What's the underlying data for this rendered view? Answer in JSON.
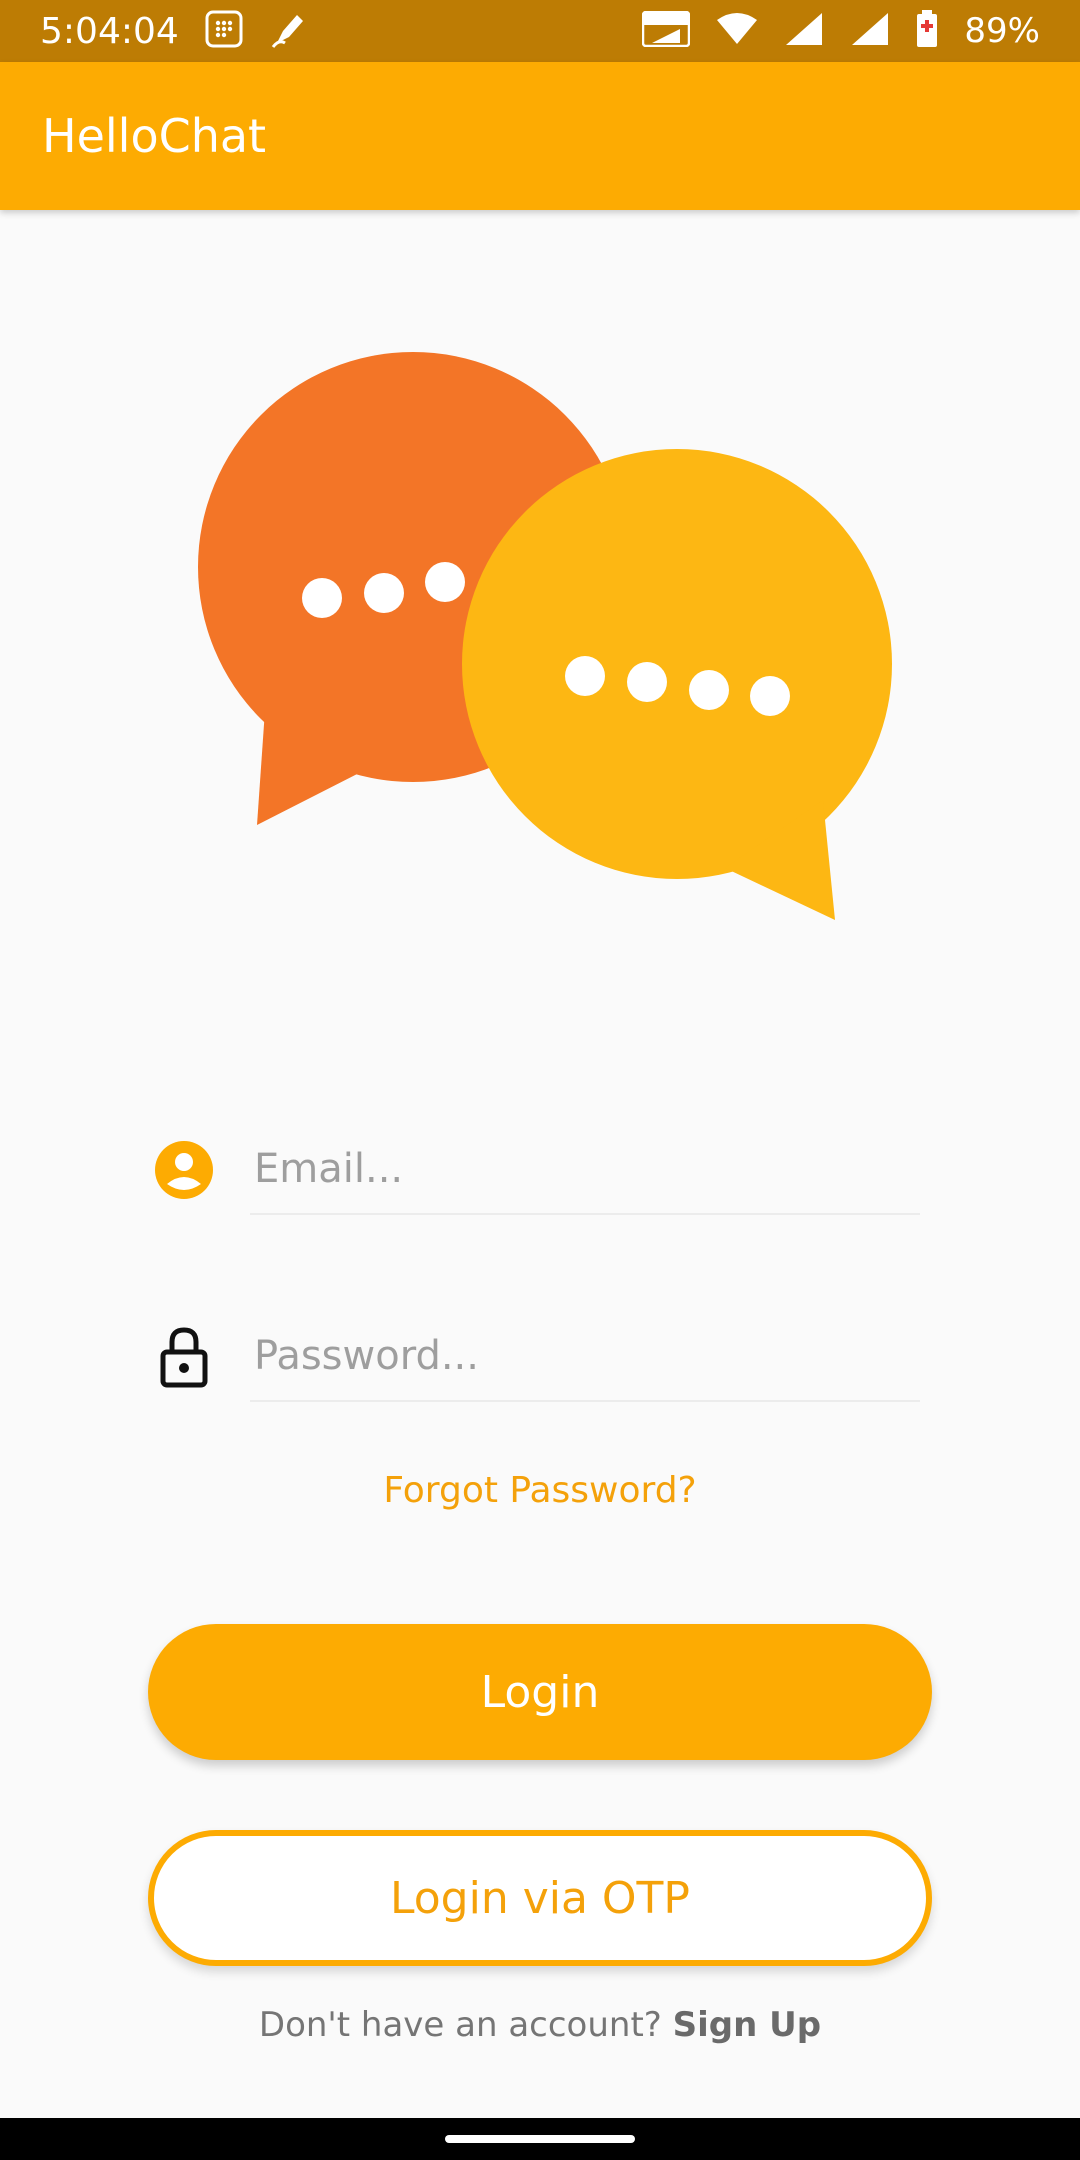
{
  "status_bar": {
    "time": "5:04:04",
    "battery_percent": "89%",
    "icons": [
      "calendar-app-icon",
      "pen-app-icon",
      "volte-icon",
      "wifi-icon",
      "signal-icon",
      "signal-icon",
      "battery-icon"
    ]
  },
  "app_bar": {
    "title": "HelloChat"
  },
  "hero": {
    "icon": "chat-bubbles-logo"
  },
  "login_form": {
    "email_placeholder": "Email...",
    "password_placeholder": "Password...",
    "forgot_password": "Forgot Password?",
    "login_button": "Login",
    "otp_button": "Login via OTP",
    "signup_prompt": "Don't have an account?",
    "signup_link": "Sign Up"
  },
  "colors": {
    "status_bar": "#bd7c04",
    "accent": "#fdab02",
    "bubble_orange": "#f37527",
    "bubble_yellow": "#fdb713",
    "link": "#f4a10a"
  }
}
